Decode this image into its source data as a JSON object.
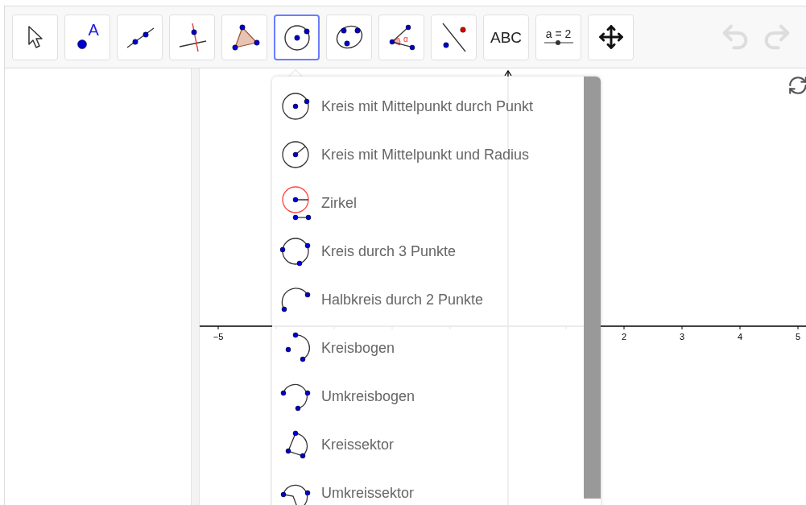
{
  "toolbar": {
    "tools": [
      {
        "kind": "move",
        "selected": false
      },
      {
        "kind": "point",
        "text": "A",
        "selected": false
      },
      {
        "kind": "line",
        "selected": false
      },
      {
        "kind": "perpendicular",
        "selected": false
      },
      {
        "kind": "polygon",
        "selected": false
      },
      {
        "kind": "circle",
        "selected": true
      },
      {
        "kind": "conic",
        "selected": false
      },
      {
        "kind": "angle",
        "text": "α",
        "selected": false
      },
      {
        "kind": "reflect",
        "selected": false
      },
      {
        "kind": "text",
        "text": "ABC",
        "selected": false
      },
      {
        "kind": "slider",
        "text": "a = 2",
        "selected": false
      },
      {
        "kind": "move-view",
        "selected": false
      }
    ],
    "undo": {
      "disabled": true
    },
    "redo": {
      "disabled": true
    }
  },
  "graphics": {
    "x_labels": [
      "−5",
      "2",
      "3",
      "4",
      "5"
    ]
  },
  "tool_menu": {
    "items": [
      {
        "kind": "circle-center-point",
        "label": "Kreis mit Mittelpunkt durch Punkt"
      },
      {
        "kind": "circle-center-radius",
        "label": "Kreis mit Mittelpunkt und Radius"
      },
      {
        "kind": "compass",
        "label": "Zirkel"
      },
      {
        "kind": "circle-3-points",
        "label": "Kreis durch 3 Punkte"
      },
      {
        "kind": "semicircle",
        "label": "Halbkreis durch 2 Punkte"
      },
      {
        "kind": "arc",
        "label": "Kreisbogen"
      },
      {
        "kind": "circumcircular-arc",
        "label": "Umkreisbogen"
      },
      {
        "kind": "sector",
        "label": "Kreissektor"
      },
      {
        "kind": "circumcircular-sector",
        "label": "Umkreissektor"
      }
    ]
  }
}
